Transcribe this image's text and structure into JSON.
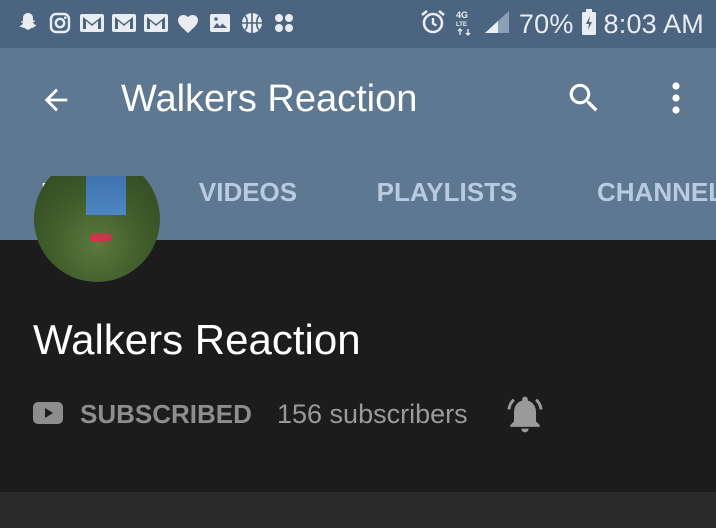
{
  "status_bar": {
    "battery": "70%",
    "time": "8:03 AM",
    "network": "4G LTE",
    "notification_icons": [
      "snapchat-icon",
      "instagram-icon",
      "gmail-icon",
      "gmail-icon",
      "gmail-icon",
      "heart-icon",
      "image-icon",
      "basketball-icon",
      "app-icon"
    ],
    "status_icons": [
      "alarm-icon",
      "signal-icon",
      "battery-icon"
    ]
  },
  "app_bar": {
    "title": "Walkers Reaction",
    "back_icon": "back-arrow-icon",
    "search_icon": "search-icon",
    "more_icon": "more-vert-icon",
    "background": "#5e7891"
  },
  "tabs": [
    {
      "label": "HOME",
      "active": true
    },
    {
      "label": "VIDEOS",
      "active": false
    },
    {
      "label": "PLAYLISTS",
      "active": false
    },
    {
      "label": "CHANNEL",
      "active": false
    }
  ],
  "channel": {
    "name": "Walkers Reaction",
    "subscribe_label": "SUBSCRIBED",
    "subscriber_count": "156 subscribers",
    "bell_icon": "notification-bell-icon",
    "youtube_icon": "youtube-icon"
  }
}
